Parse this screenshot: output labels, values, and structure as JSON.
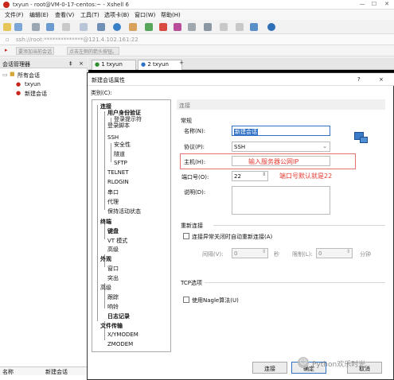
{
  "window": {
    "title": "txyun - root@VM-0-17-centos:~ - Xshell 6",
    "controls": [
      "—",
      "☐",
      "✕"
    ]
  },
  "menu": [
    "文件(F)",
    "编辑(E)",
    "查看(V)",
    "工具(T)",
    "选项卡(B)",
    "窗口(W)",
    "帮助(H)"
  ],
  "address": {
    "text": "ssh://root:**************@121.4.102.161:22"
  },
  "quickbar": [
    "要添加当前会话",
    "点击左侧的箭头按钮。"
  ],
  "session_manager": {
    "title": "会话管理器",
    "pin": "‡",
    "close": "×",
    "tree": {
      "root": "所有会话",
      "items": [
        "txyun",
        "新建会话"
      ]
    },
    "grid": {
      "col1": "名称",
      "col2": "新建会话"
    }
  },
  "tabs": [
    {
      "label": "1 txyun",
      "active": false
    },
    {
      "label": "2 txyun",
      "active": true
    }
  ],
  "tab_add": "+",
  "dialog": {
    "title": "新建会话属性",
    "help": "?",
    "close": "×",
    "category_label": "类别(C):",
    "categories": [
      {
        "label": "连接",
        "level": 0,
        "bold": true
      },
      {
        "label": "用户身份验证",
        "level": 1,
        "bold": true
      },
      {
        "label": "登录提示符",
        "level": 2,
        "bold": false
      },
      {
        "label": "登录脚本",
        "level": 1,
        "bold": false
      },
      {
        "label": "SSH",
        "level": 1,
        "bold": false
      },
      {
        "label": "安全性",
        "level": 2,
        "bold": false
      },
      {
        "label": "隧道",
        "level": 2,
        "bold": false
      },
      {
        "label": "SFTP",
        "level": 2,
        "bold": false
      },
      {
        "label": "TELNET",
        "level": 1,
        "bold": false
      },
      {
        "label": "RLOGIN",
        "level": 1,
        "bold": false
      },
      {
        "label": "串口",
        "level": 1,
        "bold": false
      },
      {
        "label": "代理",
        "level": 1,
        "bold": false
      },
      {
        "label": "保持活动状态",
        "level": 1,
        "bold": false
      },
      {
        "label": "终端",
        "level": 0,
        "bold": true
      },
      {
        "label": "键盘",
        "level": 1,
        "bold": false
      },
      {
        "label": "VT 模式",
        "level": 1,
        "bold": false
      },
      {
        "label": "高级",
        "level": 1,
        "bold": false
      },
      {
        "label": "外观",
        "level": 0,
        "bold": true
      },
      {
        "label": "窗口",
        "level": 1,
        "bold": false
      },
      {
        "label": "突出",
        "level": 1,
        "bold": false
      },
      {
        "label": "高级",
        "level": 0,
        "bold": false
      },
      {
        "label": "跟踪",
        "level": 1,
        "bold": false
      },
      {
        "label": "响铃",
        "level": 1,
        "bold": false
      },
      {
        "label": "日志记录",
        "level": 1,
        "bold": true
      },
      {
        "label": "文件传输",
        "level": 0,
        "bold": true
      },
      {
        "label": "X/YMODEM",
        "level": 1,
        "bold": false
      },
      {
        "label": "ZMODEM",
        "level": 1,
        "bold": false
      }
    ],
    "section_header": "连接",
    "general_label": "常规",
    "name_label": "名称(N):",
    "name_value": "新建会话",
    "protocol_label": "协议(P):",
    "protocol_value": "SSH",
    "host_label": "主机(H):",
    "host_value": "",
    "host_annotation": "输入服务器公网IP",
    "port_label": "端口号(O):",
    "port_value": "22",
    "port_annotation": "端口号默认就是22",
    "desc_label": "说明(D):",
    "reconnect_label": "重新连接",
    "reconnect_checkbox": "连接异常关闭时自动重新连接(A)",
    "interval_label": "间隔(V):",
    "interval_value": "0",
    "interval_unit": "秒",
    "limit_label": "限制(L):",
    "limit_value": "0",
    "limit_unit": "分钟",
    "tcp_label": "TCP选项",
    "nagle_checkbox": "使用Nagle算法(U)",
    "buttons": {
      "connect": "连接",
      "ok": "确定",
      "cancel": "取消"
    }
  },
  "watermark": "Python欢乐时光"
}
